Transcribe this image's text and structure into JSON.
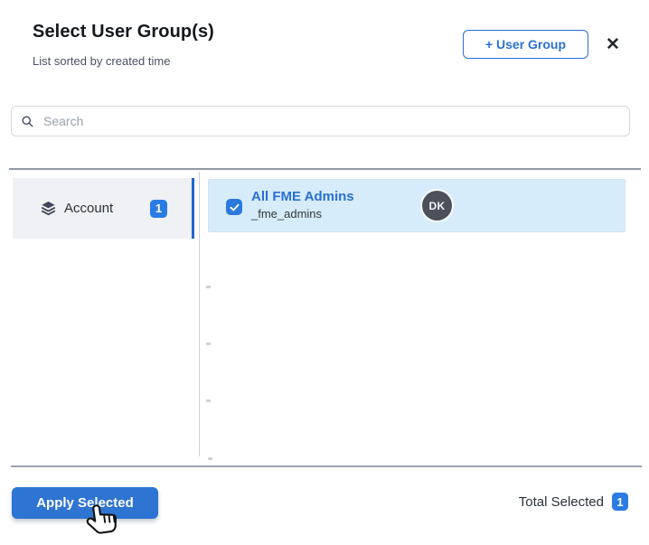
{
  "header": {
    "title": "Select User Group(s)",
    "subtitle": "List sorted by created time",
    "add_button_label": "+ User Group",
    "close_glyph": "✕"
  },
  "search": {
    "placeholder": "Search",
    "value": "",
    "icon": "magnifier"
  },
  "sidebar": {
    "items": [
      {
        "label": "Account",
        "count": "1",
        "icon": "layers-icon",
        "selected": true
      }
    ]
  },
  "groups": {
    "items": [
      {
        "name": "All FME Admins",
        "id": "_fme_admins",
        "avatar_initials": "DK",
        "checked": true,
        "selected": true
      }
    ]
  },
  "footer": {
    "apply_label": "Apply Selected",
    "total_label": "Total Selected",
    "total_count": "1"
  },
  "colors": {
    "accent": "#2a6fd4",
    "badge_blue": "#2b7ce2",
    "selected_row_bg": "#d7ecfa",
    "sidebar_selected_bg": "#eff1f4",
    "avatar_bg": "#4b505a",
    "apply_button_bg": "#2e74d2"
  }
}
